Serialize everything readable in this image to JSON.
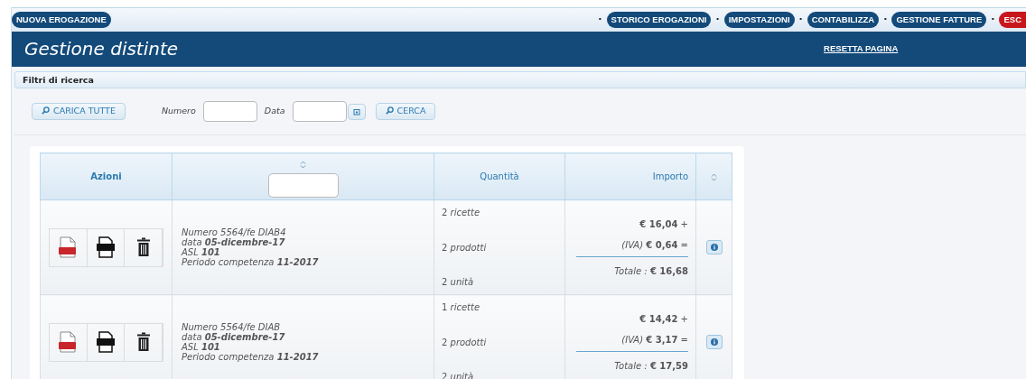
{
  "toolbar": {
    "new_button": "NUOVA EROGAZIONE",
    "nav": [
      {
        "prefix": "·",
        "label": "STORICO EROGAZIONI",
        "kind": "nav"
      },
      {
        "prefix": "·",
        "label": "IMPOSTAZIONI",
        "kind": "nav"
      },
      {
        "prefix": "·",
        "label": "CONTABILIZZA",
        "kind": "nav"
      },
      {
        "prefix": "·",
        "label": "GESTIONE FATTURE",
        "kind": "nav"
      },
      {
        "prefix": "·",
        "label": "ESC",
        "kind": "exit"
      }
    ]
  },
  "header": {
    "title": "Gestione distinte",
    "reset": "RESETTA PAGINA"
  },
  "filters": {
    "title": "Filtri di ricerca",
    "load_all": "CARICA TUTTE",
    "numero_label": "Numero",
    "data_label": "Data",
    "search": "CERCA"
  },
  "table": {
    "columns": [
      "Azioni",
      "",
      "Quantità",
      "Importo",
      ""
    ],
    "rows": [
      {
        "info": [
          "Numero 5564/fe  DIAB4",
          "data **05-dicembre-17**",
          "ASL **101**",
          "Periodo competenza **11-2017**"
        ],
        "quantity": [
          "2 *ricette*",
          "2 *prodotti*",
          "2 *unità*"
        ],
        "amount": "**€ 16,04** +",
        "vat": "*(IVA)* **€ 0,64** =",
        "total": "*Totale :* **€ 16,68**"
      },
      {
        "info": [
          "Numero 5564/fe  DIAB",
          "data **05-dicembre-17**",
          "ASL **101**",
          "Periodo competenza **11-2017**"
        ],
        "quantity": [
          "1 *ricette*",
          "2 *prodotti*",
          "2 *unità*"
        ],
        "amount": "**€ 14,42** +",
        "vat": "*(IVA)* **€ 3,17** =",
        "total": "*Totale :* **€ 17,59**"
      }
    ]
  }
}
